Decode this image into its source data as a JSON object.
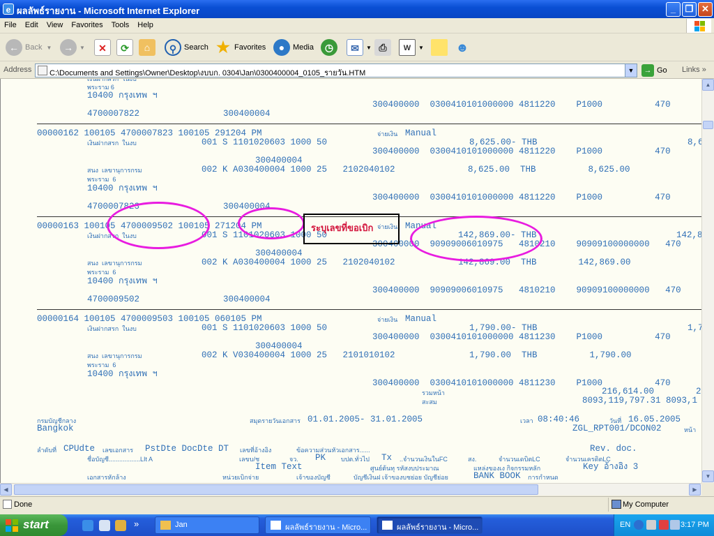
{
  "window": {
    "title": "ผลลัพธ์รายงาน - Microsoft Internet Explorer",
    "icon": "ie-page-icon",
    "controls": [
      "minimize",
      "restore",
      "close"
    ]
  },
  "menu": [
    "File",
    "Edit",
    "View",
    "Favorites",
    "Tools",
    "Help"
  ],
  "toolbar": {
    "back": "Back",
    "search": "Search",
    "favorites": "Favorites",
    "media": "Media"
  },
  "address": {
    "label": "Address",
    "value": "C:\\Documents and Settings\\Owner\\Desktop\\งบบก. 0304\\Jan\\0300400004_0105_รายวัน.HTM",
    "go": "Go",
    "links": "Links"
  },
  "report": {
    "top_partial_1": "พระราม 6",
    "top_partial_2": "10400 กรุงเทพ ฯ",
    "top_r1": "300400000  0300410101000000 4811220    P1000          470",
    "top_r2": "4700007822                300400004",
    "e162_l1": "00000162 100105 4700007823 100105 291204 PM",
    "e162_pay": "จ่ายเงิน",
    "e162_manual": "Manual",
    "e162_th1": "เงินฝากสรก  ในงบ",
    "e162_l2": "001 S 1101020603 1000 50",
    "e162_amt1": "8,625.00- THB",
    "e162_amt1b": "8,6",
    "e162_r1": "300400000  0300410101000000 4811220    P1000          470",
    "e162_dep": "300400004",
    "e162_th2": "สนง  เลขานุการกรม",
    "e162_l3": "002 K A030400004 1000 25   2102040102",
    "e162_amt2": "8,625.00  THB          8,625.00",
    "e162_th3": "พระราม  6",
    "e162_th4": "10400 กรุงเทพ ฯ",
    "e162_r2": "300400000  0300410101000000 4811220    P1000          470",
    "e162_last": "4700007823                300400004",
    "e163_l1": "00000163 100105 4700009502 100105 271204 PM",
    "e163_pay": "จ่ายเงิน",
    "e163_manual": "Manual",
    "e163_th1": "เงินฝากสรก  ในงบ",
    "e163_l2": "001 S 1101020603 1000 50",
    "e163_amt1": "142,869.00- THB",
    "e163_amt1b": "142,8",
    "e163_r1": "300400000  90909006010975   4810210    90909100000000   470",
    "e163_dep": "300400004",
    "e163_th2": "สนง  เลขานุการกรม",
    "e163_l3": "002 K A030400004 1000 25   2102040102",
    "e163_amt2": "142,869.00  THB        142,869.00",
    "e163_th3": "พระราม  6",
    "e163_th4": "10400 กรุงเทพ ฯ",
    "e163_r2": "300400000  90909006010975   4810210    90909100000000   470",
    "e163_last": "4700009502                300400004",
    "e164_l1": "00000164 100105 4700009503 100105 060105 PM",
    "e164_pay": "จ่ายเงิน",
    "e164_manual": "Manual",
    "e164_th1": "เงินฝากสรก  ในงบ",
    "e164_l2": "001 S 1101020603 1000 50",
    "e164_amt1": "1,790.00- THB",
    "e164_amt1b": "1,7",
    "e164_r1": "300400000  0300410101000000 4811230    P1000          470",
    "e164_dep": "300400004",
    "e164_th2": "สนง  เลขานุการกรม",
    "e164_l3": "002 K V030400004 1000 25   2101010102",
    "e164_amt2": "1,790.00  THB          1,790.00",
    "e164_th3": "พระราม  6",
    "e164_th4": "10400 กรุงเทพ ฯ",
    "e164_r2": "300400000  0300410101000000 4811230    P1000          470",
    "total_label1": "รวมหน้า",
    "total_val1": "216,614.00        21",
    "total_label2": "สะสม",
    "total_val2": "8093,119,797.31 8093,1",
    "f_org": "กรมบัญชีกลาง",
    "f_city": "Bangkok",
    "f_book_label": "สมุดรายวันเอกสาร",
    "f_period": "01.01.2005- 31.01.2005",
    "f_time_label": "เวลา",
    "f_time": "08:40:46",
    "f_date_label": "วันที่",
    "f_date": "16.05.2005",
    "f_report": "ZGL_RPT001/DCON02",
    "f_page_label": "หน้า",
    "h1_a": "ลำดับที่",
    "h1_b": "CPUdte",
    "h1_c": "เลขเอกสาร",
    "h1_d": "PstDte DocDte DT",
    "h1_e": "เลขที่อ้างอิง",
    "h1_f": "ข้อความส่วนหัวเอกสาร......",
    "h1_g": "Rev. doc.",
    "h2_a": "ชื่อบัญชี..................LIt A",
    "h2_b": "เลขบ/ช",
    "h2_c": "จว.",
    "h2_d": "PK",
    "h2_e": "บปต.ทั่วไป",
    "h2_f": "Tx",
    "h2_g": "..จำนวนเงินในFC",
    "h2_h": "สง.",
    "h2_i": "จำนวนเดบิตLC",
    "h2_j": "จำนวนเครดิตLC",
    "h3_a": "Item Text",
    "h3_b": "ศูนย์ต้นทุ รหัสงบประมาณ",
    "h3_c": "แหล่งของเง กิจกรรมหลัก",
    "h3_d": "Key อ้างอิง 3",
    "h4_a": "เอกสารหักล้าง",
    "h4_b": "หน่วยเบิกจ่าย",
    "h4_c": "เจ้าของบัญชี",
    "h4_d": "บัญชีเงินฝ เจ้าของบชย่อย บัญชีย่อย",
    "h4_e": "BANK BOOK",
    "h4_f": "การกำหนด"
  },
  "annotation": {
    "text": "ระบุเลขที่ขอเบิก",
    "color": "#d3173e",
    "ellipse_color": "#e81ce0"
  },
  "status": {
    "text": "Done",
    "zone": "My Computer"
  },
  "taskbar": {
    "start": "start",
    "tasks": [
      "Jan",
      "ผลลัพธ์รายงาน - Micro...",
      "ผลลัพธ์รายงาน - Micro..."
    ],
    "lang": "EN",
    "clock": "3:17 PM"
  }
}
